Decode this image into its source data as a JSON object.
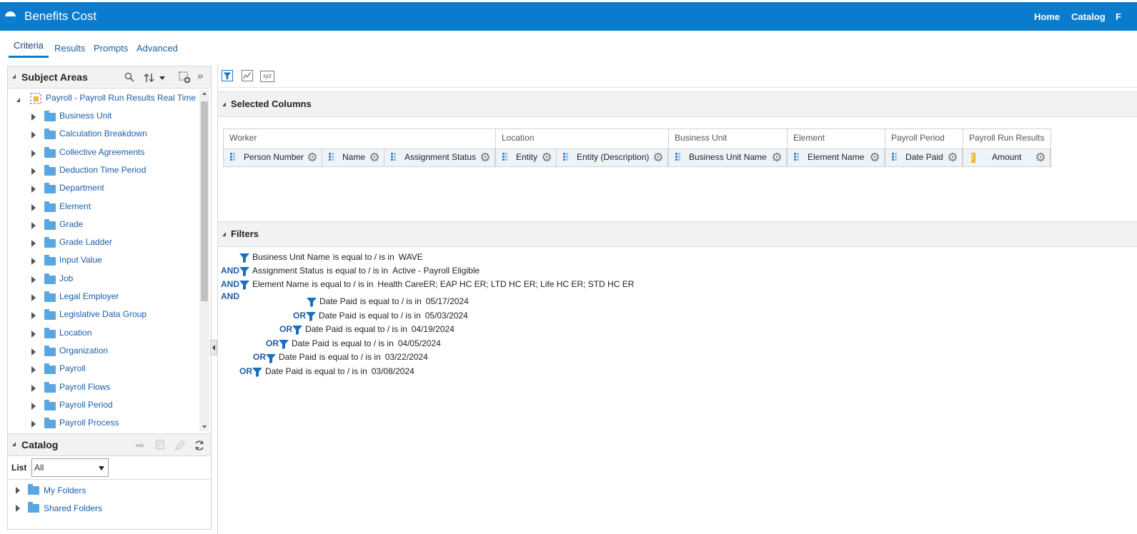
{
  "app": {
    "title": "Benefits Cost"
  },
  "topnav": {
    "home": "Home",
    "catalog": "Catalog",
    "more": "F"
  },
  "tabs": [
    "Criteria",
    "Results",
    "Prompts",
    "Advanced"
  ],
  "subject_areas": {
    "title": "Subject Areas",
    "root": "Payroll - Payroll Run Results Real Time",
    "items": [
      "Business Unit",
      "Calculation Breakdown",
      "Collective Agreements",
      "Deduction Time Period",
      "Department",
      "Element",
      "Grade",
      "Grade Ladder",
      "Input Value",
      "Job",
      "Legal Employer",
      "Legislative Data Group",
      "Location",
      "Organization",
      "Payroll",
      "Payroll Flows",
      "Payroll Period",
      "Payroll Process"
    ]
  },
  "catalog": {
    "title": "Catalog",
    "list_label": "List",
    "list_value": "All",
    "folders": [
      "My Folders",
      "Shared Folders"
    ]
  },
  "toolbar": {
    "xyz": "xyz"
  },
  "selected_columns": {
    "title": "Selected Columns",
    "groups": [
      {
        "label": "Worker",
        "columns": [
          "Person Number",
          "Name",
          "Assignment Status"
        ]
      },
      {
        "label": "Location",
        "columns": [
          "Entity",
          "Entity (Description)"
        ]
      },
      {
        "label": "Business Unit",
        "columns": [
          "Business Unit Name"
        ]
      },
      {
        "label": "Element",
        "columns": [
          "Element Name"
        ]
      },
      {
        "label": "Payroll Period",
        "columns": [
          "Date Paid"
        ]
      },
      {
        "label": "Payroll Run Results",
        "columns": [
          "Amount"
        ]
      }
    ]
  },
  "filters": {
    "title": "Filters",
    "and_label": "AND",
    "or_label": "OR",
    "operator_text": "is equal to / is in",
    "top": [
      {
        "field": "Business Unit Name",
        "value": "WAVE"
      },
      {
        "field": "Assignment Status",
        "value": "Active - Payroll Eligible"
      },
      {
        "field": "Element Name",
        "value": "Health CareER; EAP HC ER; LTD HC ER; Life HC ER; STD HC ER"
      }
    ],
    "dates": [
      {
        "field": "Date Paid",
        "value": "05/17/2024"
      },
      {
        "field": "Date Paid",
        "value": "05/03/2024"
      },
      {
        "field": "Date Paid",
        "value": "04/19/2024"
      },
      {
        "field": "Date Paid",
        "value": "04/05/2024"
      },
      {
        "field": "Date Paid",
        "value": "03/22/2024"
      },
      {
        "field": "Date Paid",
        "value": "03/08/2024"
      }
    ]
  }
}
